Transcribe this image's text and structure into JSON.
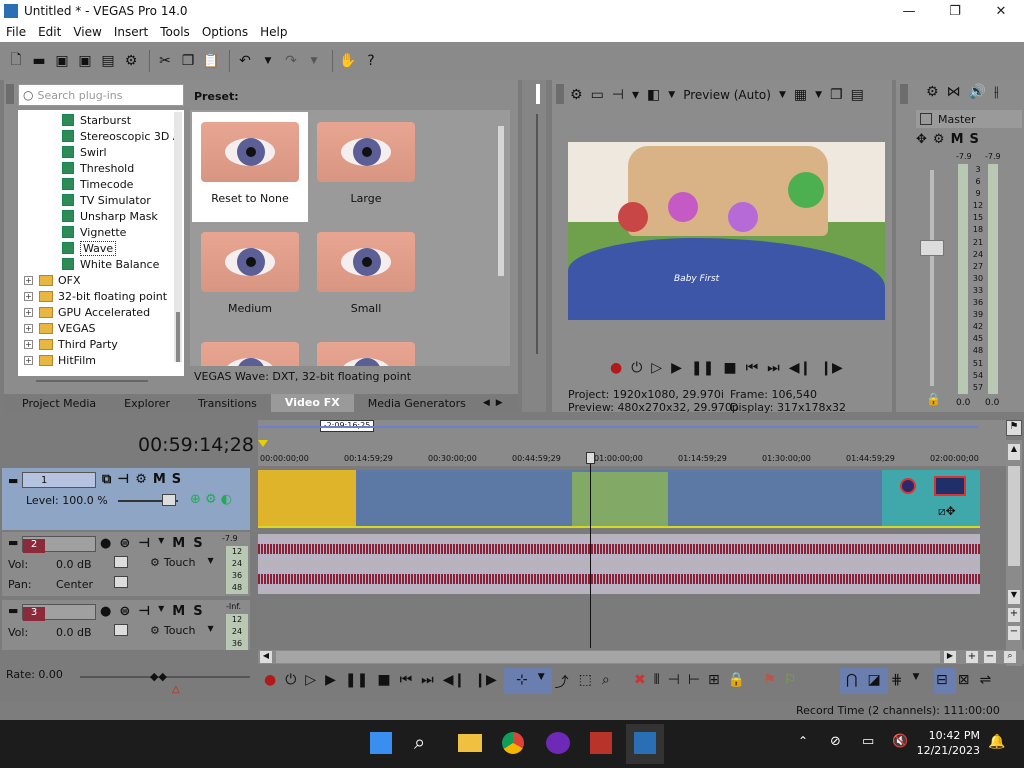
{
  "window": {
    "title": "Untitled * - VEGAS Pro 14.0",
    "minimize": "—",
    "maximize": "❐",
    "close": "✕"
  },
  "menu": [
    "File",
    "Edit",
    "View",
    "Insert",
    "Tools",
    "Options",
    "Help"
  ],
  "plugins": {
    "search_placeholder": "Search plug-ins",
    "preset_label": "Preset:",
    "fx_items": [
      "Starburst",
      "Stereoscopic 3D A",
      "Swirl",
      "Threshold",
      "Timecode",
      "TV Simulator",
      "Unsharp Mask",
      "Vignette",
      "Wave",
      "White Balance"
    ],
    "folders": [
      "OFX",
      "32-bit floating point",
      "GPU Accelerated",
      "VEGAS",
      "Third Party",
      "HitFilm"
    ],
    "presets": [
      "Reset to None",
      "Large",
      "Medium",
      "Small"
    ],
    "status": "VEGAS Wave: DXT, 32-bit floating point"
  },
  "tabs": [
    "Project Media",
    "Explorer",
    "Transitions",
    "Video FX",
    "Media Generators"
  ],
  "preview": {
    "mode": "Preview (Auto)",
    "project_label": "Project:",
    "project_value": "1920x1080, 29.970i",
    "preview_label": "Preview:",
    "preview_value": "480x270x32, 29.970p",
    "frame_label": "Frame:",
    "frame_value": "106,540",
    "display_label": "Display:",
    "display_value": "317x178x32",
    "video_text": "Baby First"
  },
  "master": {
    "title": "Master",
    "m": "M",
    "s": "S",
    "left_peak": "-7.9",
    "right_peak": "-7.9",
    "scale": [
      "3",
      "6",
      "9",
      "12",
      "15",
      "18",
      "21",
      "24",
      "27",
      "30",
      "33",
      "36",
      "39",
      "42",
      "45",
      "48",
      "51",
      "54",
      "57"
    ],
    "bottom_left": "0.0",
    "bottom_right": "0.0"
  },
  "timeline": {
    "timecode": "00:59:14;28",
    "region_length": "-2:09:16;25",
    "ruler": [
      "00:00:00;00",
      "00:14:59;29",
      "00:30:00;00",
      "00:44:59;29",
      "01:00:00;00",
      "01:14:59;29",
      "01:30:00;00",
      "01:44:59;29",
      "02:00:00;00"
    ],
    "rate": "Rate: 0.00"
  },
  "tracks": [
    {
      "num": "1",
      "label": "Level: 100.0 %",
      "m": "M",
      "s": "S"
    },
    {
      "num": "2",
      "vol_label": "Vol:",
      "vol": "0.0 dB",
      "pan_label": "Pan:",
      "pan": "Center",
      "mode": "Touch",
      "m": "M",
      "s": "S",
      "peak": "-7.9",
      "meter": [
        "12",
        "24",
        "36",
        "48"
      ]
    },
    {
      "num": "3",
      "vol_label": "Vol:",
      "vol": "0.0 dB",
      "mode": "Touch",
      "m": "M",
      "s": "S",
      "peak": "-Inf.",
      "meter": [
        "12",
        "24",
        "36"
      ]
    }
  ],
  "status": {
    "record_time": "Record Time (2 channels): 111:00:00"
  },
  "taskbar": {
    "time": "10:42 PM",
    "date": "12/21/2023"
  }
}
